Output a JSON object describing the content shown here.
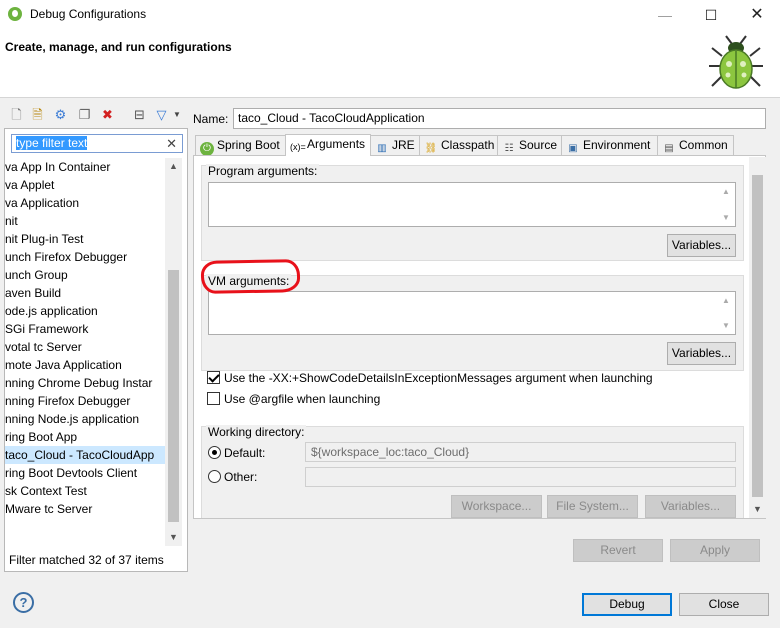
{
  "window": {
    "title": "Debug Configurations",
    "minimize": "—",
    "maximize": "☐",
    "close": "✕"
  },
  "banner": {
    "title": "Create, manage, and run configurations"
  },
  "left": {
    "filter_placeholder": "type filter text",
    "tree_items": [
      "va App In Container",
      "va Applet",
      "va Application",
      "nit",
      "nit Plug-in Test",
      "unch Firefox Debugger",
      "unch Group",
      "aven Build",
      "ode.js application",
      "SGi Framework",
      "votal tc Server",
      "mote Java Application",
      "nning Chrome Debug Instar",
      "nning Firefox Debugger",
      "nning Node.js application",
      "ring Boot App",
      "taco_Cloud - TacoCloudApp",
      "ring Boot Devtools Client",
      "sk Context Test",
      "Mware tc Server"
    ],
    "selected_index": 16,
    "status": "Filter matched 32 of 37 items"
  },
  "config": {
    "name_label": "Name:",
    "name_value": "taco_Cloud - TacoCloudApplication",
    "tabs": [
      {
        "label": "Spring Boot",
        "icon": "spring-icon"
      },
      {
        "label": "Arguments",
        "icon": "arguments-icon"
      },
      {
        "label": "JRE",
        "icon": "jre-icon"
      },
      {
        "label": "Classpath",
        "icon": "classpath-icon"
      },
      {
        "label": "Source",
        "icon": "source-icon"
      },
      {
        "label": "Environment",
        "icon": "environment-icon"
      },
      {
        "label": "Common",
        "icon": "common-icon"
      }
    ],
    "active_tab": "Arguments",
    "program_args_label": "Program arguments:",
    "vm_args_label": "VM arguments:",
    "variables_label": "Variables...",
    "show_code_details_label": "Use the -XX:+ShowCodeDetailsInExceptionMessages argument when launching",
    "show_code_details_checked": true,
    "argfile_label": "Use @argfile when launching",
    "argfile_checked": false,
    "working_dir_label": "Working directory:",
    "default_label": "Default:",
    "default_value": "${workspace_loc:taco_Cloud}",
    "other_label": "Other:",
    "workspace_button": "Workspace...",
    "filesystem_button": "File System...",
    "variables_button2": "Variables..."
  },
  "footer": {
    "revert": "Revert",
    "apply": "Apply",
    "debug": "Debug",
    "close": "Close",
    "help": "?"
  },
  "colors": {
    "highlight": "#e8111a",
    "selection": "#cce8ff",
    "focus_border": "#0078d7"
  }
}
